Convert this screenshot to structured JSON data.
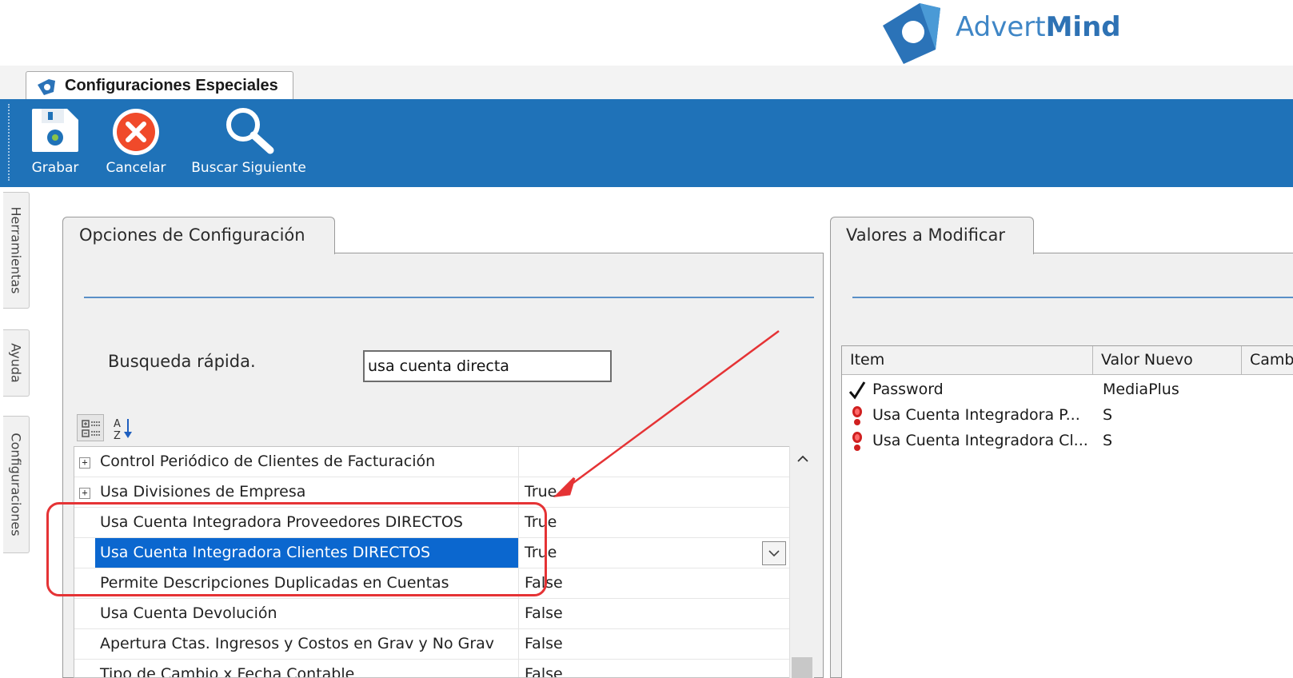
{
  "logo": {
    "light": "Advert",
    "bold": "Mind"
  },
  "document_tab": {
    "title": "Configuraciones Especiales"
  },
  "ribbon": {
    "buttons": [
      {
        "label": "Grabar",
        "icon": "save-icon"
      },
      {
        "label": "Cancelar",
        "icon": "cancel-icon"
      },
      {
        "label": "Buscar Siguiente",
        "icon": "search-icon"
      }
    ]
  },
  "side_tabs": [
    "Herramientas",
    "Ayuda",
    "Configuraciones"
  ],
  "left_panel": {
    "tab_label": "Opciones de Configuración",
    "quick_search": {
      "label": "Busqueda rápida.",
      "value": "usa cuenta directa"
    },
    "grid_rows": [
      {
        "name": "Control Periódico de Clientes de Facturación",
        "value": "",
        "expandable": "+"
      },
      {
        "name": "Usa Divisiones de Empresa",
        "value": "True",
        "expandable": "+"
      },
      {
        "name": "Usa Cuenta Integradora Proveedores DIRECTOS",
        "value": "True"
      },
      {
        "name": "Usa Cuenta Integradora Clientes DIRECTOS",
        "value": "True"
      },
      {
        "name": "Permite Descripciones Duplicadas en Cuentas",
        "value": "False"
      },
      {
        "name": "Usa Cuenta Devolución",
        "value": "False"
      },
      {
        "name": "Apertura Ctas. Ingresos y Costos en Grav y No Grav",
        "value": "False"
      },
      {
        "name": "Tipo de Cambio x Fecha Contable",
        "value": "False"
      }
    ]
  },
  "right_panel": {
    "tab_label": "Valores a Modificar",
    "columns": [
      "Item",
      "Valor Nuevo",
      "Cambio"
    ],
    "rows": [
      {
        "icon": "checkmark-icon",
        "item": "Password",
        "value": "MediaPlus"
      },
      {
        "icon": "exclamation-icon",
        "item": "Usa Cuenta Integradora P...",
        "value": "S"
      },
      {
        "icon": "exclamation-icon",
        "item": "Usa Cuenta Integradora Cl...",
        "value": "S"
      }
    ]
  },
  "colors": {
    "ribbon": "#1f72b8",
    "selection": "#0b67cf",
    "annotation": "#e53335",
    "brand": "#3f86c6"
  }
}
